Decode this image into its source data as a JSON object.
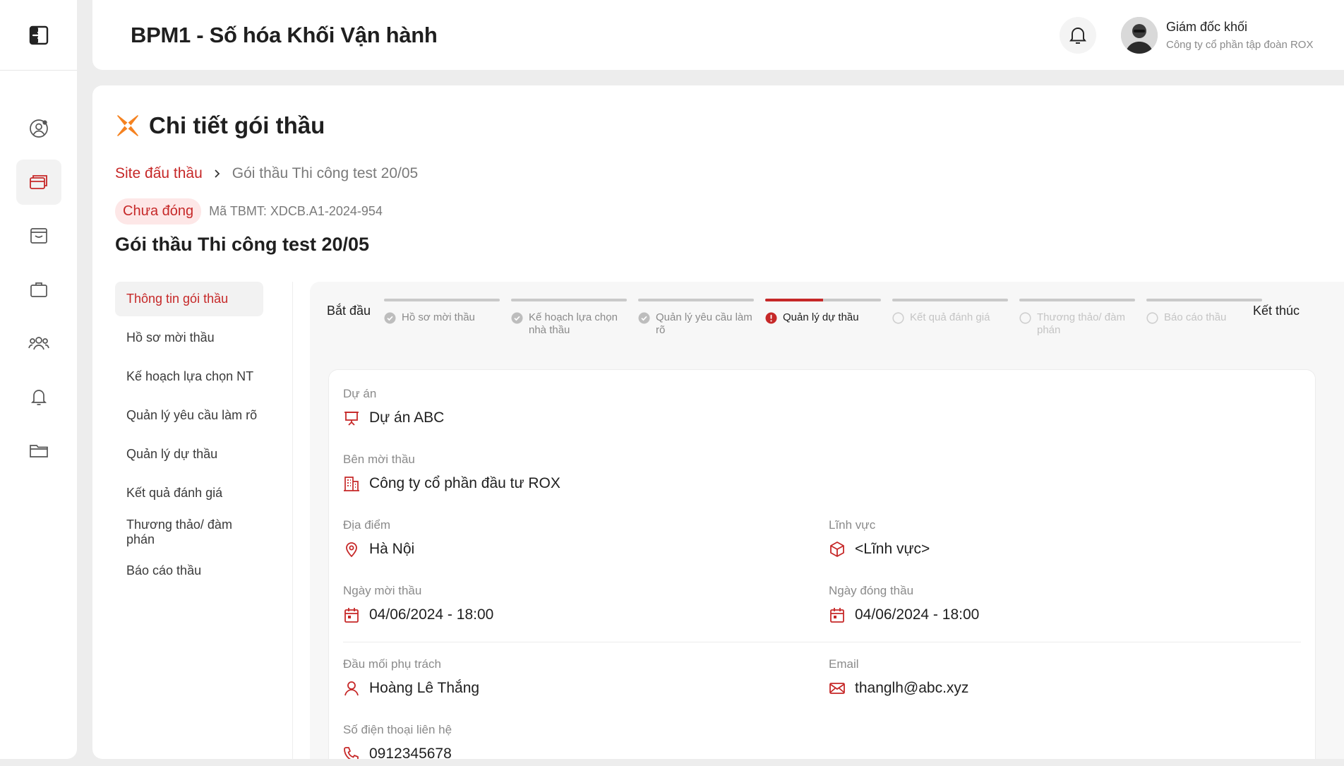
{
  "header": {
    "app_title": "BPM1 - Số hóa Khối Vận hành",
    "user_name": "Giám đốc khối",
    "user_company": "Công ty cổ phần tập đoàn ROX"
  },
  "sidebar": {
    "icons": [
      "collapse-sidebar-icon",
      "user-settings-icon",
      "cards-icon",
      "inbox-icon",
      "briefcase-icon",
      "users-icon",
      "bell-icon",
      "folder-icon"
    ],
    "active_index": 1
  },
  "page": {
    "title": "Chi tiết gói thầu",
    "breadcrumb": {
      "link": "Site đấu thầu",
      "current": "Gói thầu Thi công test 20/05"
    },
    "status": "Chưa đóng",
    "tbmt": "Mã TBMT: XDCB.A1-2024-954",
    "package_title": "Gói thầu Thi công test 20/05"
  },
  "subnav": {
    "items": [
      "Thông tin gói thầu",
      "Hồ sơ mời thầu",
      "Kế hoạch lựa chọn NT",
      "Quản lý yêu cầu làm rõ",
      "Quản lý dự thầu",
      "Kết quả đánh giá",
      "Thương thảo/ đàm phán",
      "Báo cáo thầu"
    ],
    "active_index": 0
  },
  "stepper": {
    "start_label": "Bắt đầu",
    "end_label": "Kết thúc",
    "steps": [
      {
        "label": "Hồ sơ mời thầu",
        "state": "done"
      },
      {
        "label": "Kế hoạch lựa chọn nhà thầu",
        "state": "done"
      },
      {
        "label": "Quản lý yêu cầu làm rõ",
        "state": "done"
      },
      {
        "label": "Quản lý dự thầu",
        "state": "active",
        "progress": 0.5
      },
      {
        "label": "Kết quả đánh giá",
        "state": "pending"
      },
      {
        "label": "Thương thảo/ đàm phán",
        "state": "pending"
      },
      {
        "label": "Báo cáo thầu",
        "state": "pending"
      }
    ]
  },
  "details": {
    "project": {
      "label": "Dự án",
      "value": "Dự án ABC"
    },
    "inviter": {
      "label": "Bên mời thầu",
      "value": "Công ty cổ phần đầu tư ROX"
    },
    "location": {
      "label": "Địa điểm",
      "value": "Hà Nội"
    },
    "field": {
      "label": "Lĩnh vực",
      "value": "<Lĩnh vực>"
    },
    "invite_date": {
      "label": "Ngày mời thầu",
      "value": "04/06/2024 - 18:00"
    },
    "close_date": {
      "label": "Ngày đóng thầu",
      "value": "04/06/2024 - 18:00"
    },
    "contact": {
      "label": "Đầu mối phụ trách",
      "value": "Hoàng Lê Thắng"
    },
    "email": {
      "label": "Email",
      "value": "thanglh@abc.xyz"
    },
    "phone": {
      "label": "Số điện thoại liên hệ",
      "value": "0912345678"
    }
  },
  "colors": {
    "accent": "#c62828",
    "logo_orange": "#f58220",
    "background": "#ededed"
  }
}
